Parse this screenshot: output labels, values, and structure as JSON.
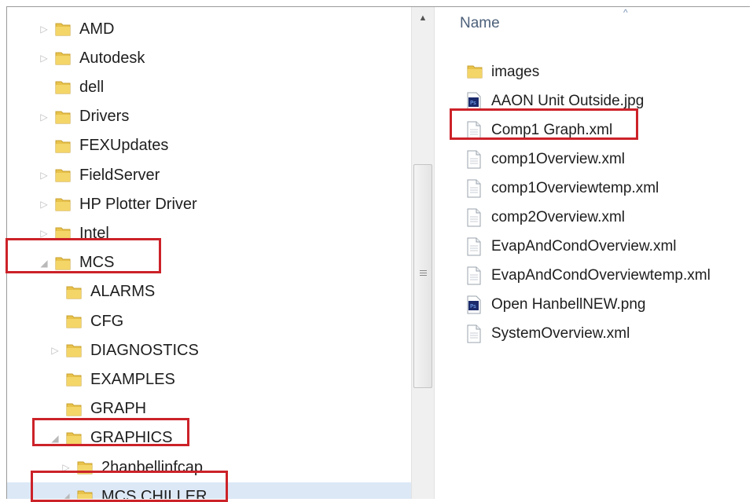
{
  "tree": {
    "items": [
      {
        "label": "AMD",
        "expand": "▷"
      },
      {
        "label": "Autodesk",
        "expand": "▷"
      },
      {
        "label": "dell",
        "expand": ""
      },
      {
        "label": "Drivers",
        "expand": "▷"
      },
      {
        "label": "FEXUpdates",
        "expand": ""
      },
      {
        "label": "FieldServer",
        "expand": "▷"
      },
      {
        "label": "HP Plotter Driver",
        "expand": "▷"
      },
      {
        "label": "Intel",
        "expand": "▷"
      },
      {
        "label": "MCS",
        "expand": "◢"
      },
      {
        "label": "ALARMS",
        "expand": ""
      },
      {
        "label": "CFG",
        "expand": ""
      },
      {
        "label": "DIAGNOSTICS",
        "expand": "▷"
      },
      {
        "label": "EXAMPLES",
        "expand": ""
      },
      {
        "label": "GRAPH",
        "expand": ""
      },
      {
        "label": "GRAPHICS",
        "expand": "◢"
      },
      {
        "label": "2hanbellinfcap",
        "expand": "▷"
      },
      {
        "label": "MCS CHILLER",
        "expand": "◢",
        "selected": true
      }
    ]
  },
  "scrollbar": {
    "up_arrow": "▲",
    "grip": "≡"
  },
  "files": {
    "column_header": "Name",
    "sort_indicator": "^",
    "items": [
      {
        "label": "images",
        "icon": "folder-icon"
      },
      {
        "label": "AAON Unit Outside.jpg",
        "icon": "photoshop-file-icon"
      },
      {
        "label": "Comp1 Graph.xml",
        "icon": "document-icon"
      },
      {
        "label": "comp1Overview.xml",
        "icon": "document-icon"
      },
      {
        "label": "comp1Overviewtemp.xml",
        "icon": "document-icon"
      },
      {
        "label": "comp2Overview.xml",
        "icon": "document-icon"
      },
      {
        "label": "EvapAndCondOverview.xml",
        "icon": "document-icon"
      },
      {
        "label": "EvapAndCondOverviewtemp.xml",
        "icon": "document-icon"
      },
      {
        "label": "Open HanbellNEW.png",
        "icon": "photoshop-file-icon"
      },
      {
        "label": "SystemOverview.xml",
        "icon": "document-icon"
      }
    ]
  },
  "colors": {
    "highlight_box": "#cc2229",
    "folder": "#e8c24a",
    "selection": "#dce8f6"
  }
}
